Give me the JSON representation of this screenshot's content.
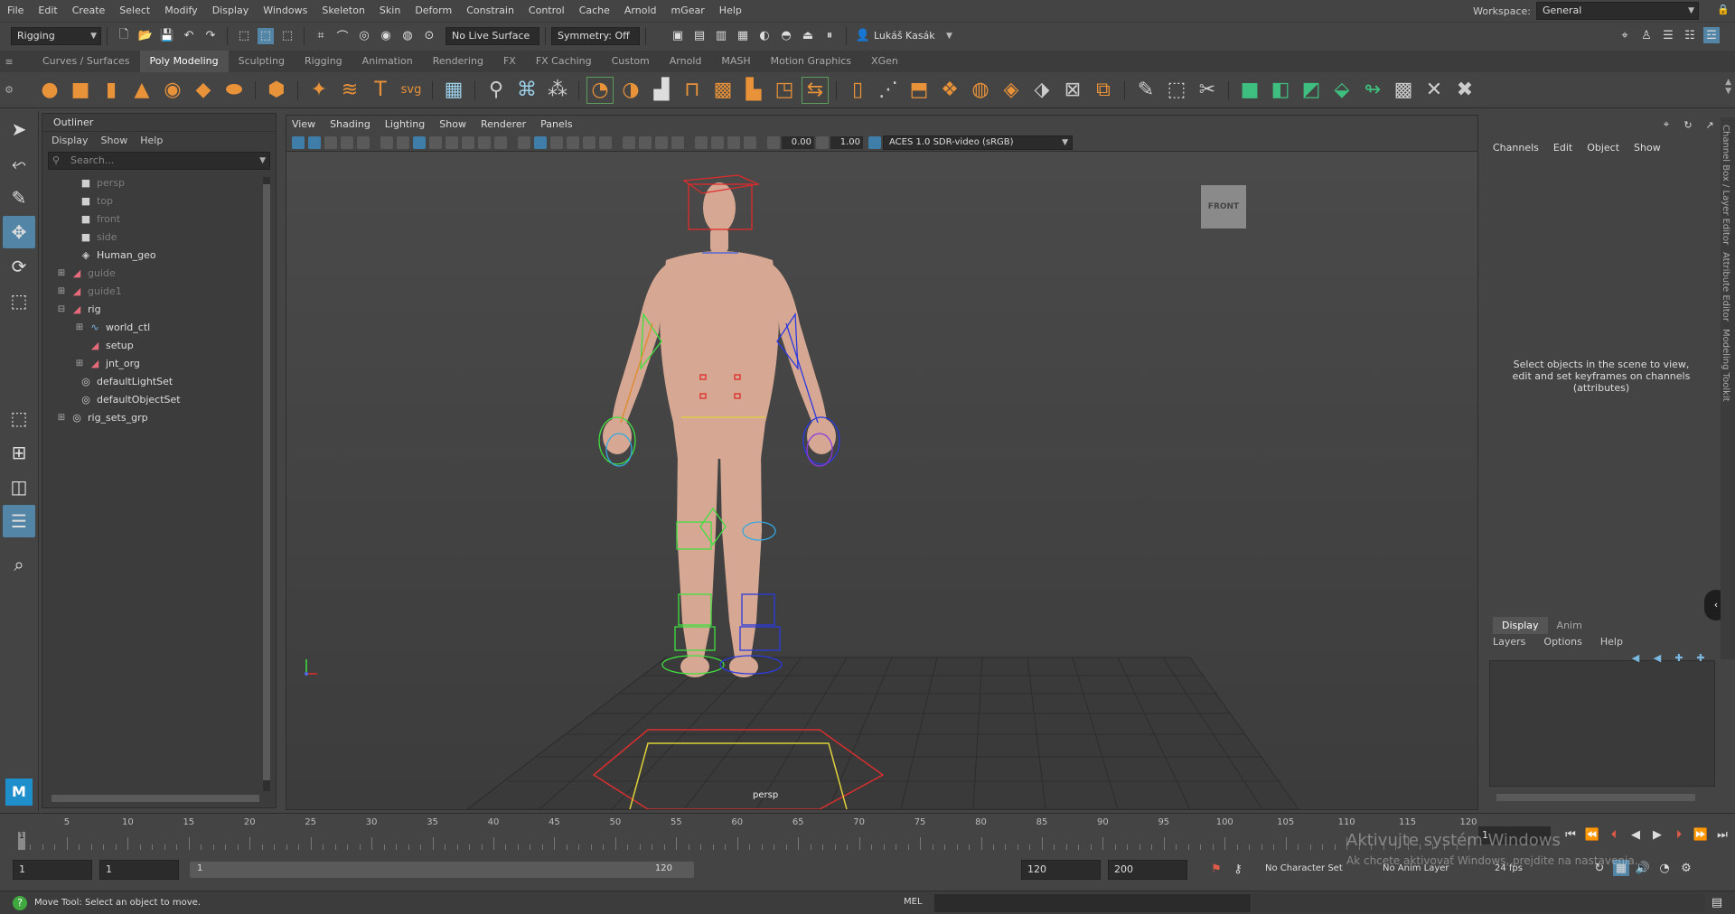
{
  "menubar": {
    "items": [
      "File",
      "Edit",
      "Create",
      "Select",
      "Modify",
      "Display",
      "Windows",
      "Skeleton",
      "Skin",
      "Deform",
      "Constrain",
      "Control",
      "Cache",
      "Arnold",
      "mGear",
      "Help"
    ],
    "workspace_label": "Workspace:",
    "workspace_value": "General"
  },
  "statusline": {
    "menuset": "Rigging",
    "live_surface": "No Live Surface",
    "symmetry": "Symmetry: Off",
    "user": "Lukáš Kasák"
  },
  "shelf": {
    "tabs": [
      "Curves / Surfaces",
      "Poly Modeling",
      "Sculpting",
      "Rigging",
      "Animation",
      "Rendering",
      "FX",
      "FX Caching",
      "Custom",
      "Arnold",
      "MASH",
      "Motion Graphics",
      "XGen"
    ],
    "active_tab": "Poly Modeling"
  },
  "outliner": {
    "title": "Outliner",
    "menus": [
      "Display",
      "Show",
      "Help"
    ],
    "search_placeholder": "Search...",
    "items": [
      {
        "label": "persp",
        "dim": true,
        "indent": 1,
        "icon": "camera-icon"
      },
      {
        "label": "top",
        "dim": true,
        "indent": 1,
        "icon": "camera-icon"
      },
      {
        "label": "front",
        "dim": true,
        "indent": 1,
        "icon": "camera-icon"
      },
      {
        "label": "side",
        "dim": true,
        "indent": 1,
        "icon": "camera-icon"
      },
      {
        "label": "Human_geo",
        "dim": false,
        "indent": 1,
        "icon": "mesh-icon"
      },
      {
        "label": "guide",
        "dim": true,
        "indent": 0,
        "expand": "+",
        "icon": "transform-icon"
      },
      {
        "label": "guide1",
        "dim": true,
        "indent": 0,
        "expand": "+",
        "icon": "transform-icon"
      },
      {
        "label": "rig",
        "dim": false,
        "indent": 0,
        "expand": "−",
        "icon": "transform-icon"
      },
      {
        "label": "world_ctl",
        "dim": false,
        "indent": 2,
        "expand": "+",
        "icon": "curve-icon"
      },
      {
        "label": "setup",
        "dim": false,
        "indent": 2,
        "icon": "transform-icon"
      },
      {
        "label": "jnt_org",
        "dim": false,
        "indent": 2,
        "expand": "+",
        "icon": "transform-icon"
      },
      {
        "label": "defaultLightSet",
        "dim": false,
        "indent": 1,
        "icon": "set-icon"
      },
      {
        "label": "defaultObjectSet",
        "dim": false,
        "indent": 1,
        "icon": "set-icon"
      },
      {
        "label": "rig_sets_grp",
        "dim": false,
        "indent": 0,
        "expand": "+",
        "icon": "set-icon"
      }
    ]
  },
  "viewport": {
    "menus": [
      "View",
      "Shading",
      "Lighting",
      "Show",
      "Renderer",
      "Panels"
    ],
    "exposure": "0.00",
    "gamma": "1.00",
    "colorspace": "ACES 1.0 SDR-video (sRGB)",
    "camera_label": "persp",
    "viewcube_label": "FRONT"
  },
  "channelbox": {
    "menus": [
      "Channels",
      "Edit",
      "Object",
      "Show"
    ],
    "message": "Select objects in the scene to view, edit and set keyframes on channels (attributes)",
    "side_tabs": [
      "Channel Box / Layer Editor",
      "Attribute Editor",
      "Modeling Toolkit"
    ]
  },
  "layereditor": {
    "tabs": [
      "Display",
      "Anim"
    ],
    "active_tab": "Display",
    "menus": [
      "Layers",
      "Options",
      "Help"
    ]
  },
  "timeline": {
    "ticks": [
      5,
      10,
      15,
      20,
      25,
      30,
      35,
      40,
      45,
      50,
      55,
      60,
      65,
      70,
      75,
      80,
      85,
      90,
      95,
      100,
      105,
      110,
      115,
      120
    ],
    "current_frame": "1",
    "current_field": "1",
    "start_min": "1",
    "start": "1",
    "range_start": "1",
    "range_end": "120",
    "end": "120",
    "end_max": "200",
    "character_set": "No Character Set",
    "anim_layer": "No Anim Layer",
    "fps": "24 fps"
  },
  "helpline": {
    "message": "Move Tool: Select an object to move.",
    "mel_label": "MEL"
  },
  "watermark": {
    "line1": "Aktivujte systém Windows",
    "line2": "Ak chcete aktivovať Windows, prejdite na nastavenia."
  }
}
